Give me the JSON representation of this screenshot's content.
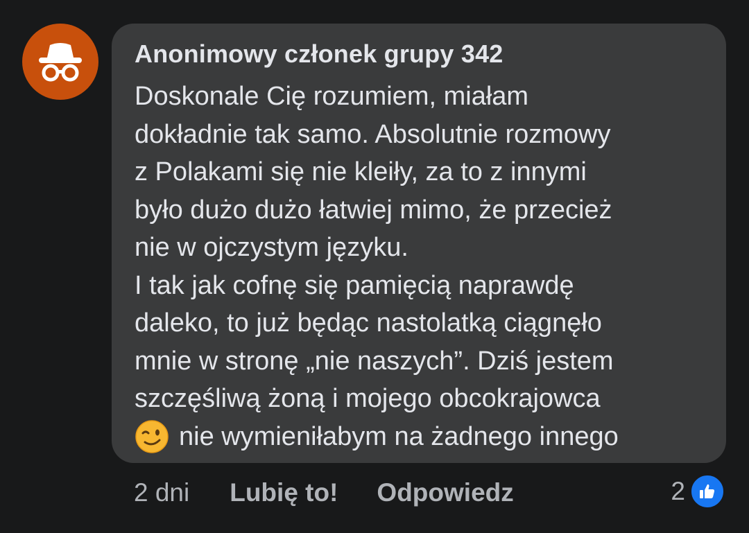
{
  "comment": {
    "author": "Anonimowy członek grupy 342",
    "avatar_icon": "incognito-icon",
    "lines": [
      "Doskonale Cię rozumiem, miałam",
      "dokładnie tak samo. Absolutnie rozmowy",
      "z Polakami się nie kleiły, za to z innymi",
      "było dużo dużo łatwiej mimo, że przecież",
      "nie w ojczystym języku.",
      "I tak jak cofnę się pamięcią naprawdę",
      "daleko, to już będąc nastolatką ciągnęło",
      "mnie w stronę „nie naszych”. Dziś jestem",
      "szczęśliwą żoną i mojego obcokrajowca",
      "nie wymieniłabym na żadnego innego"
    ],
    "emoji": "winking-face-icon"
  },
  "actions": {
    "time": "2 dni",
    "like_label": "Lubię to!",
    "reply_label": "Odpowiedz"
  },
  "reactions": {
    "count": "2",
    "icon": "thumbs-up-icon"
  },
  "colors": {
    "background": "#18191a",
    "bubble": "#3a3b3c",
    "avatar": "#c8500c",
    "text": "#e4e6eb",
    "secondary_text": "#b0b3b8",
    "like_blue": "#1877f2"
  }
}
